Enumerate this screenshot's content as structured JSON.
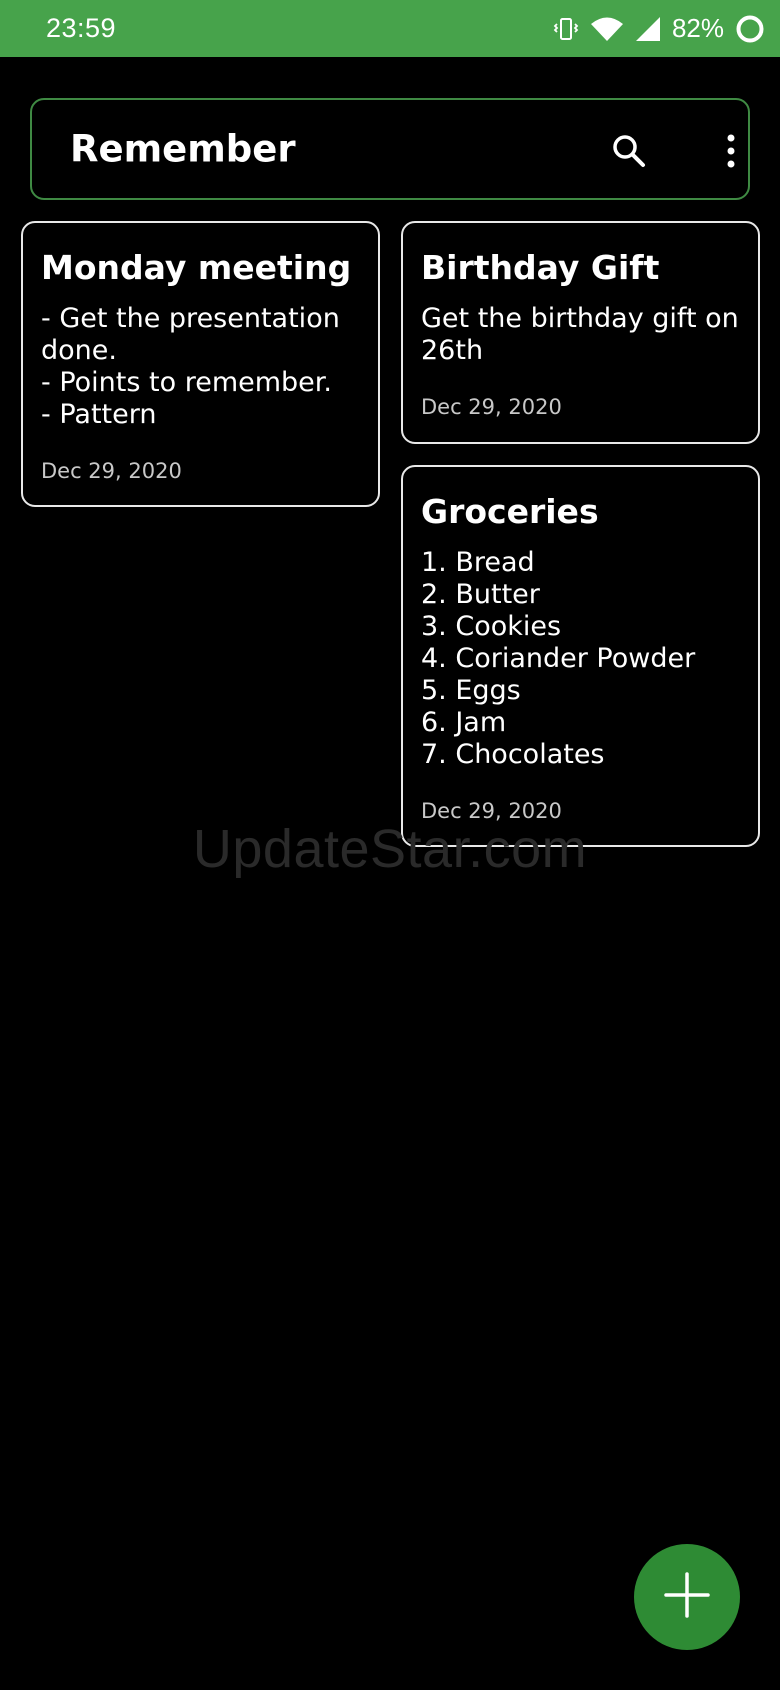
{
  "status_bar": {
    "time": "23:59",
    "battery_text": "82%",
    "icons": [
      "vibrate-icon",
      "wifi-icon",
      "cell-signal-icon",
      "battery-ring-icon"
    ],
    "background_color": "#47a34b"
  },
  "toolbar": {
    "title": "Remember",
    "search_icon": "search-icon",
    "more_icon": "more-vert-icon",
    "border_color": "#3f8a43"
  },
  "notes": [
    {
      "title": "Monday meeting",
      "body": [
        "- Get the presentation",
        "done.",
        "- Points to remember.",
        "- Pattern"
      ],
      "date": "Dec 29, 2020"
    },
    {
      "title": "Birthday Gift",
      "body": [
        "Get the birthday gift on",
        "26th"
      ],
      "date": "Dec 29, 2020"
    },
    {
      "title": "Groceries",
      "body": [
        "1. Bread",
        "2. Butter",
        "3. Cookies",
        "4. Coriander Powder",
        "5. Eggs",
        "6. Jam",
        "7. Chocolates"
      ],
      "date": "Dec 29, 2020"
    }
  ],
  "watermark": "UpdateStar.com",
  "fab": {
    "icon": "plus-icon",
    "color": "#2e8b34"
  }
}
